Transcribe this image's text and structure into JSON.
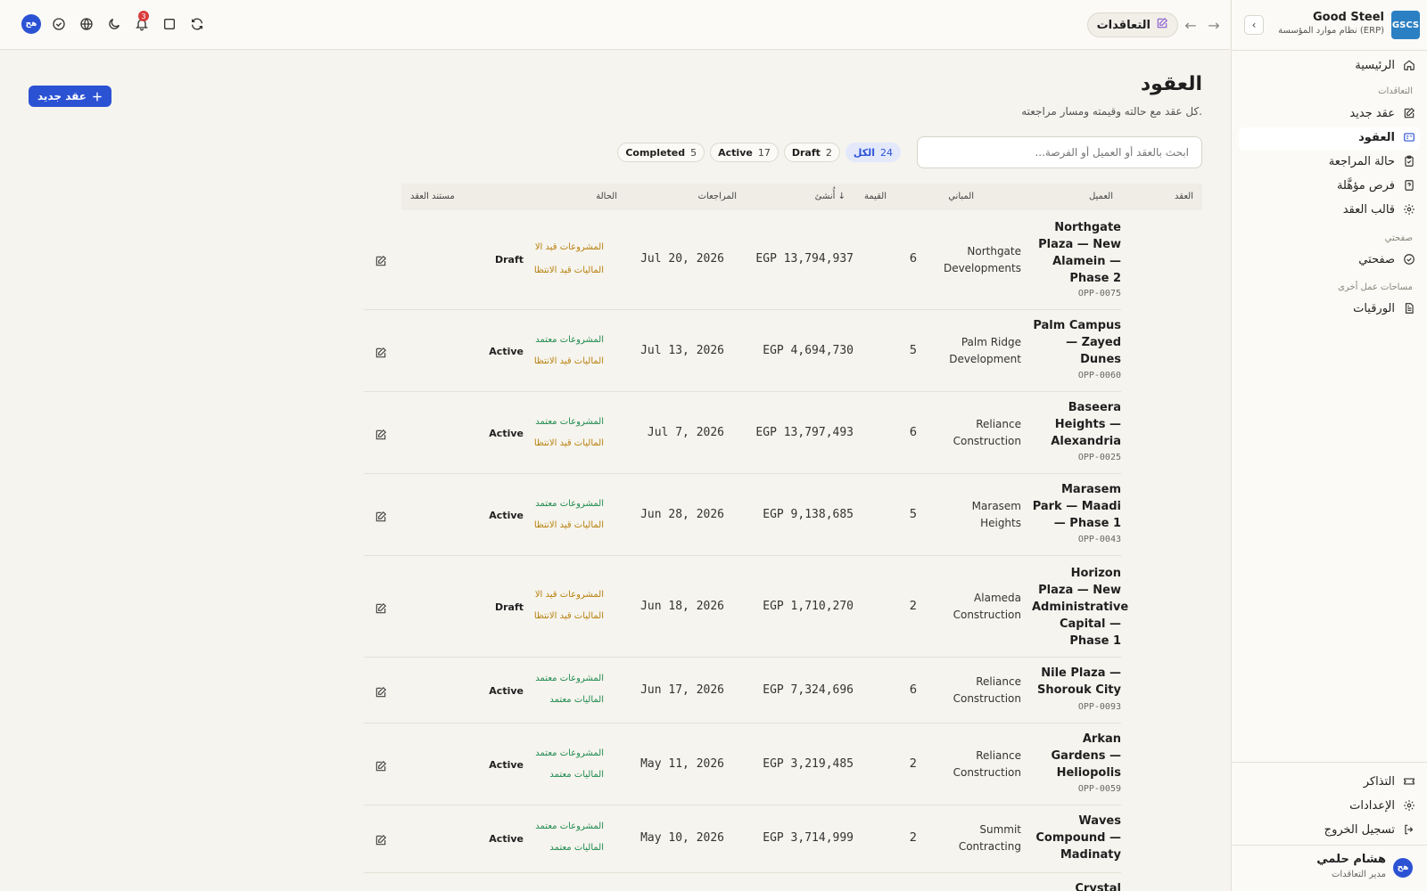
{
  "brand": {
    "logo": "GSCS",
    "name": "Good Steel",
    "subtitle": "نظام موارد المؤسسة (ERP)",
    "collapse_icon": "‹"
  },
  "sidebar": {
    "home": "الرئيسية",
    "section_contracts": "التعاقدات",
    "items": [
      {
        "label": "عقد جديد",
        "icon": "edit-icon"
      },
      {
        "label": "العقود",
        "icon": "contracts-icon"
      },
      {
        "label": "حالة المراجعة",
        "icon": "clipboard-icon"
      },
      {
        "label": "فرص مؤهَّلة",
        "icon": "file-question-icon"
      },
      {
        "label": "قالب العقد",
        "icon": "gear-icon"
      }
    ],
    "section_mypage": "صفحتي",
    "mypage": "صفحتي",
    "section_other": "مساحات عمل أخرى",
    "papers": "الورقيات",
    "tickets": "التذاكر",
    "settings": "الإعدادات",
    "logout": "تسجيل الخروج",
    "user_name": "هشام حلمي",
    "user_role": "مدير التعاقدات",
    "user_initials": "هح"
  },
  "topbar": {
    "breadcrumb": "التعاقدات",
    "notifications": "3",
    "user_initials": "هح"
  },
  "page": {
    "title": "العقود",
    "subtitle": "كل عقد مع حالته وقيمته ومسار مراجعته.",
    "new_button": "عقد جديد",
    "search_placeholder": "ابحث بالعقد أو العميل أو الفرصة..."
  },
  "filters": [
    {
      "label": "الكل",
      "count": "24",
      "active": true
    },
    {
      "label": "Draft",
      "count": "2",
      "active": false
    },
    {
      "label": "Active",
      "count": "17",
      "active": false
    },
    {
      "label": "Completed",
      "count": "5",
      "active": false
    }
  ],
  "columns": {
    "contract": "العقد",
    "client": "العميل",
    "buildings": "المباني",
    "value": "القيمة",
    "created": "أُنشئ ↓",
    "reviews": "المراجعات",
    "status": "الحالة",
    "document": "مستند العقد"
  },
  "rows": [
    {
      "title": "Northgate Plaza — New Alamein — Phase 2",
      "opp": "OPP-0075",
      "client": "Northgate Developments",
      "buildings": "6",
      "value": "EGP 13,794,937",
      "date": "Jul 20, 2026",
      "rev1": "المشروعات قيد الا",
      "rev1_state": "pending",
      "rev2": "الماليات قيد الانتظا",
      "rev2_state": "pending",
      "status": "Draft"
    },
    {
      "title": "Palm Campus — Zayed Dunes",
      "opp": "OPP-0060",
      "client": "Palm Ridge Development",
      "buildings": "5",
      "value": "EGP 4,694,730",
      "date": "Jul 13, 2026",
      "rev1": "المشروعات معتمد",
      "rev1_state": "ok",
      "rev2": "الماليات قيد الانتظا",
      "rev2_state": "pending",
      "status": "Active"
    },
    {
      "title": "Baseera Heights — Alexandria",
      "opp": "OPP-0025",
      "client": "Reliance Construction",
      "buildings": "6",
      "value": "EGP 13,797,493",
      "date": "Jul 7, 2026",
      "rev1": "المشروعات معتمد",
      "rev1_state": "ok",
      "rev2": "الماليات قيد الانتظا",
      "rev2_state": "pending",
      "status": "Active"
    },
    {
      "title": "Marasem Park — Maadi — Phase 1",
      "opp": "OPP-0043",
      "client": "Marasem Heights",
      "buildings": "5",
      "value": "EGP 9,138,685",
      "date": "Jun 28, 2026",
      "rev1": "المشروعات معتمد",
      "rev1_state": "ok",
      "rev2": "الماليات قيد الانتظا",
      "rev2_state": "pending",
      "status": "Active"
    },
    {
      "title": "Horizon Plaza — New Administrative Capital — Phase 1",
      "opp": "",
      "client": "Alameda Construction",
      "buildings": "2",
      "value": "EGP 1,710,270",
      "date": "Jun 18, 2026",
      "rev1": "المشروعات قيد الا",
      "rev1_state": "pending",
      "rev2": "الماليات قيد الانتظا",
      "rev2_state": "pending",
      "status": "Draft"
    },
    {
      "title": "Nile Plaza — Shorouk City",
      "opp": "OPP-0093",
      "client": "Reliance Construction",
      "buildings": "6",
      "value": "EGP 7,324,696",
      "date": "Jun 17, 2026",
      "rev1": "المشروعات معتمد",
      "rev1_state": "ok",
      "rev2": "الماليات معتمد",
      "rev2_state": "ok",
      "status": "Active"
    },
    {
      "title": "Arkan Gardens — Heliopolis",
      "opp": "OPP-0059",
      "client": "Reliance Construction",
      "buildings": "2",
      "value": "EGP 3,219,485",
      "date": "May 11, 2026",
      "rev1": "المشروعات معتمد",
      "rev1_state": "ok",
      "rev2": "الماليات معتمد",
      "rev2_state": "ok",
      "status": "Active"
    },
    {
      "title": "Waves Compound — Madinaty",
      "opp": "",
      "client": "Summit Contracting",
      "buildings": "2",
      "value": "EGP 3,714,999",
      "date": "May 10, 2026",
      "rev1": "المشروعات معتمد",
      "rev1_state": "ok",
      "rev2": "الماليات معتمد",
      "rev2_state": "ok",
      "status": "Active"
    },
    {
      "title": "Crystal",
      "opp": "",
      "client": "",
      "buildings": "",
      "value": "",
      "date": "",
      "rev1": "",
      "rev1_state": "ok",
      "rev2": "",
      "rev2_state": "ok",
      "status": ""
    }
  ]
}
